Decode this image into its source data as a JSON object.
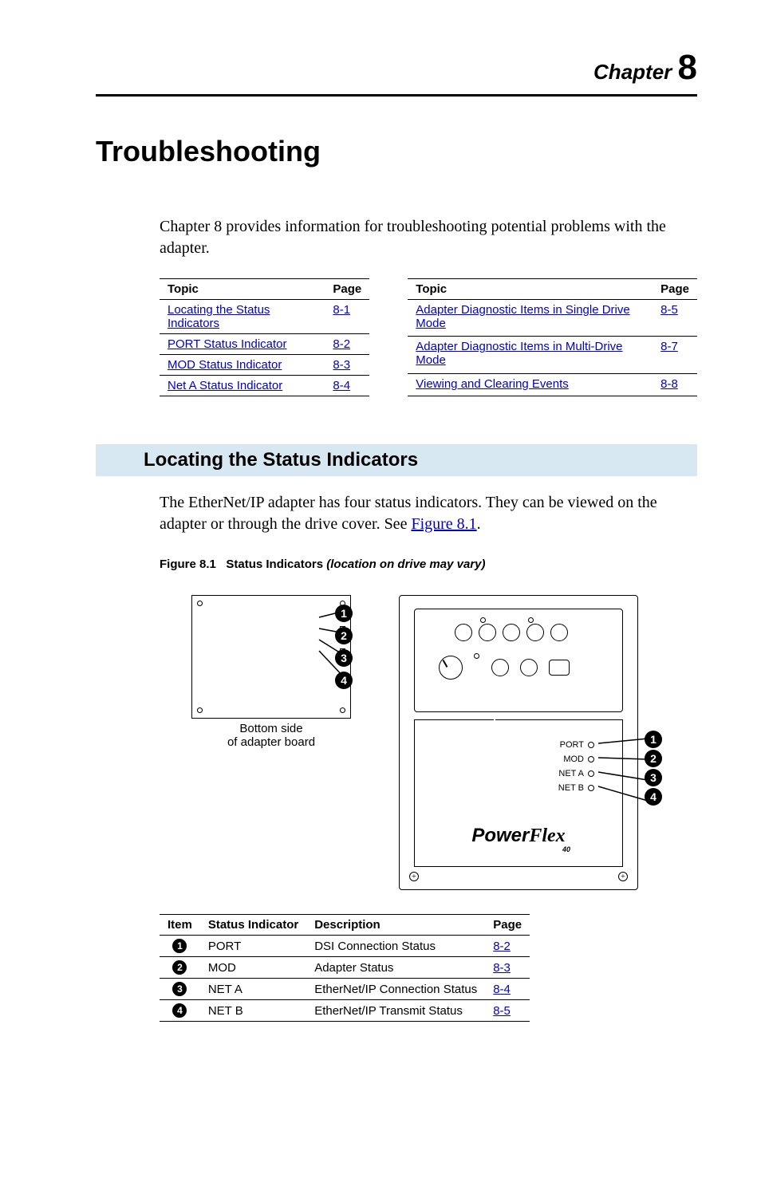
{
  "chapter": {
    "label": "Chapter",
    "num": "8"
  },
  "title": "Troubleshooting",
  "intro": "Chapter 8 provides information for troubleshooting potential problems with the adapter.",
  "toc": {
    "header": {
      "topic": "Topic",
      "page": "Page"
    },
    "left": [
      {
        "topic": "Locating the Status Indicators",
        "page": "8-1"
      },
      {
        "topic": "PORT Status Indicator",
        "page": "8-2"
      },
      {
        "topic": "MOD Status Indicator",
        "page": "8-3"
      },
      {
        "topic": "Net A Status Indicator",
        "page": "8-4"
      }
    ],
    "right": [
      {
        "topic": "Adapter Diagnostic Items in Single Drive Mode",
        "page": "8-5"
      },
      {
        "topic": "Adapter Diagnostic Items in Multi-Drive Mode",
        "page": "8-7"
      },
      {
        "topic": "Viewing and Clearing Events",
        "page": "8-8"
      }
    ]
  },
  "section": {
    "heading": "Locating the Status Indicators",
    "text_a": "The EtherNet/IP adapter has four status indicators. They can be viewed on the adapter or through the drive cover. See ",
    "figref": "Figure 8.1",
    "text_b": "."
  },
  "fig_caption": {
    "prefix": "Figure 8.1",
    "title": "Status Indicators",
    "note": "(location on drive may vary)"
  },
  "board": {
    "label1": "Bottom side",
    "label2": "of adapter board"
  },
  "drive": {
    "leds": {
      "port": "PORT",
      "mod": "MOD",
      "neta": "NET A",
      "netb": "NET B"
    },
    "brand_a": "Power",
    "brand_b": "Flex",
    "brand_sub": "40"
  },
  "items": {
    "header": {
      "item": "Item",
      "ind": "Status Indicator",
      "desc": "Description",
      "page": "Page"
    },
    "rows": [
      {
        "n": "1",
        "ind": "PORT",
        "desc": "DSI Connection Status",
        "page": "8-2"
      },
      {
        "n": "2",
        "ind": "MOD",
        "desc": "Adapter Status",
        "page": "8-3"
      },
      {
        "n": "3",
        "ind": "NET A",
        "desc": "EtherNet/IP Connection Status",
        "page": "8-4"
      },
      {
        "n": "4",
        "ind": "NET B",
        "desc": "EtherNet/IP Transmit Status",
        "page": "8-5"
      }
    ]
  }
}
